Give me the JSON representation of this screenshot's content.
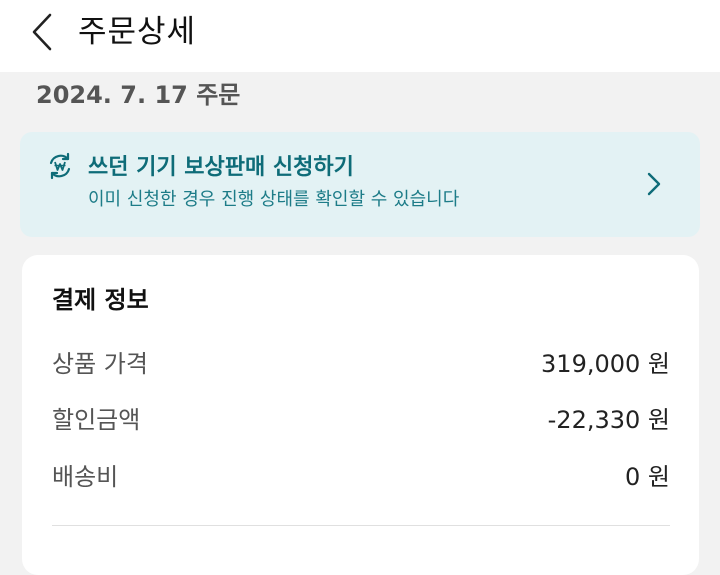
{
  "header": {
    "title": "주문상세"
  },
  "order": {
    "date_label": "2024. 7. 17 주문"
  },
  "tradein_banner": {
    "title": "쓰던 기기 보상판매 신청하기",
    "subtitle": "이미 신청한 경우 진행 상태를 확인할 수 있습니다",
    "accent_color": "#0e6c78",
    "background_color": "#e3f2f4",
    "icon": "trade-in-won-cycle-icon"
  },
  "payment": {
    "title": "결제 정보",
    "rows": [
      {
        "label": "상품 가격",
        "value": "319,000 원"
      },
      {
        "label": "할인금액",
        "value": "-22,330 원"
      },
      {
        "label": "배송비",
        "value": "0 원"
      }
    ]
  }
}
